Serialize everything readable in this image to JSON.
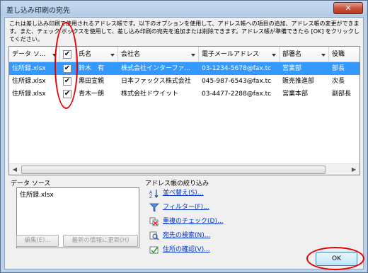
{
  "window": {
    "title": "差し込み印刷の宛先",
    "close_glyph": "✕"
  },
  "description": "これは差し込み印刷で使用されるアドレス帳です。以下のオプションを使用して、アドレス帳への項目の追加、アドレス帳の変更ができます。また、チェック ボックスを使用して、差し込み印刷の宛先を追加または削除できます。アドレス帳が準備できたら [OK] をクリックしてください。",
  "grid": {
    "columns": [
      "データ ソ...",
      "",
      "氏名",
      "会社名",
      "電子メールアドレス",
      "部署名",
      "役職"
    ],
    "rows": [
      {
        "source": "住所録.xlsx",
        "checked": "✔",
        "name": "鈴木　有",
        "company": "株式会社インターファ...",
        "email": "03-1234-5678@fax.tc",
        "dept": "営業部",
        "title": "部長"
      },
      {
        "source": "住所録.xlsx",
        "checked": "✔",
        "name": "黒田宣親",
        "company": "日本ファックス株式会社",
        "email": "045-987-6543@fax.tc",
        "dept": "販売推進部",
        "title": "次長"
      },
      {
        "source": "住所録.xlsx",
        "checked": "✔",
        "name": "青木一朗",
        "company": "株式会社ドウイット",
        "email": "03-4477-2288@fax.tc",
        "dept": "営業本部",
        "title": "副部長"
      }
    ]
  },
  "data_source": {
    "label": "データ ソース",
    "items": [
      "住所録.xlsx"
    ],
    "edit_button": "編集(E)...",
    "refresh_button": "最新の情報に更新(H)"
  },
  "refine": {
    "label": "アドレス帳の絞り込み",
    "links": [
      {
        "label": "並べ替え(S)...",
        "icon": "sort-icon"
      },
      {
        "label": "フィルター(F)...",
        "icon": "filter-icon"
      },
      {
        "label": "重複のチェック(D)...",
        "icon": "duplicates-icon"
      },
      {
        "label": "宛先の検索(N)...",
        "icon": "find-recipient-icon"
      },
      {
        "label": "住所の確認(V)...",
        "icon": "validate-address-icon"
      }
    ]
  },
  "ok_button": "OK",
  "colors": {
    "selection": "#3399ff",
    "annotation": "#e60000",
    "link": "#0033cc"
  }
}
